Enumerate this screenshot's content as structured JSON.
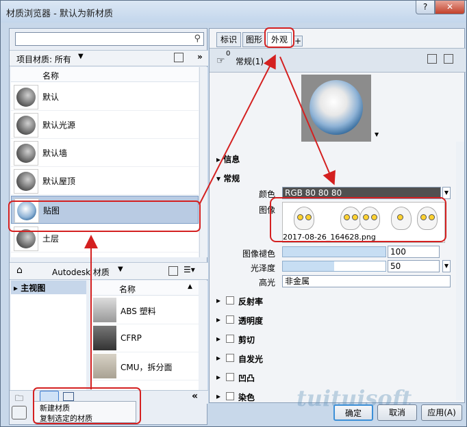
{
  "window": {
    "title": "材质浏览器 - 默认为新材质",
    "help": "?",
    "close": "✕"
  },
  "left": {
    "search_placeholder": "",
    "project_label": "项目材质: 所有",
    "column_name": "名称",
    "materials": [
      "默认",
      "默认光源",
      "默认墙",
      "默认屋顶",
      "贴图",
      "土层"
    ],
    "library_path": "Autodesk 材质",
    "tree_root": "主视图",
    "lib_column_name": "名称",
    "lib_materials": [
      "ABS 塑料",
      "CFRP",
      "CMU，拆分面"
    ]
  },
  "context_menu": {
    "items": [
      "新建材质",
      "复制选定的材质"
    ]
  },
  "right": {
    "tabs": [
      "标识",
      "图形",
      "外观",
      "+"
    ],
    "asset_count": "0",
    "asset_name": "常规(1)",
    "sections": {
      "info": "信息",
      "general": "常规"
    },
    "props": {
      "color_label": "颜色",
      "color_value": "RGB 80 80 80",
      "image_label": "图像",
      "image_file": "2017-08-26_164628.png",
      "fade_label": "图像褪色",
      "fade_value": "100",
      "fade_fraction": 1.0,
      "gloss_label": "光泽度",
      "gloss_value": "50",
      "gloss_fraction": 0.5,
      "highlight_label": "高光",
      "highlight_value": "非金属"
    },
    "collapsed": [
      "反射率",
      "透明度",
      "剪切",
      "自发光",
      "凹凸",
      "染色"
    ]
  },
  "buttons": {
    "ok": "确定",
    "cancel": "取消",
    "apply": "应用(A)"
  },
  "watermark": "tuituisoft",
  "colors": {
    "annotation_red": "#d42020",
    "selection": "#b9cbe3"
  }
}
